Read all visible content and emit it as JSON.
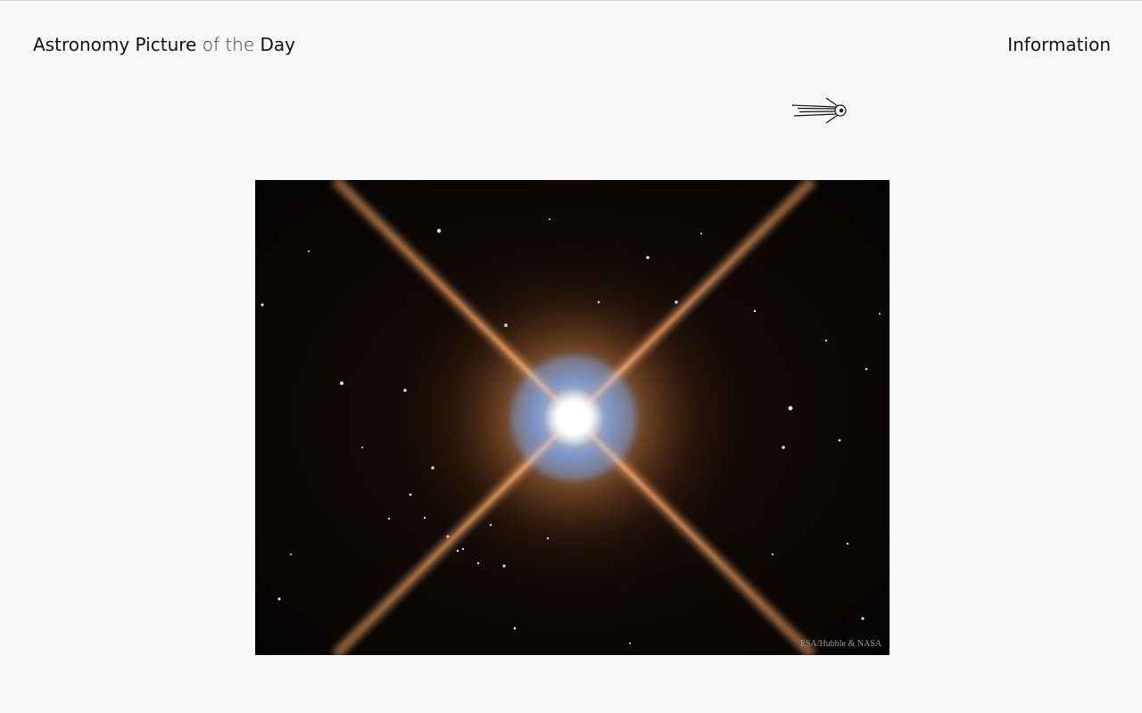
{
  "header": {
    "title_part1": "Astronomy Picture",
    "title_part2": " of the ",
    "title_part3": "Day",
    "info_link": "Information"
  },
  "icons": {
    "logo": "satellite-icon"
  },
  "apod": {
    "image_credit": "ESA/Hubble & NASA"
  },
  "colors": {
    "background": "#f9f9f9",
    "text": "#111111",
    "image_background": "#060403",
    "credit_text": "#9a9a9a"
  }
}
